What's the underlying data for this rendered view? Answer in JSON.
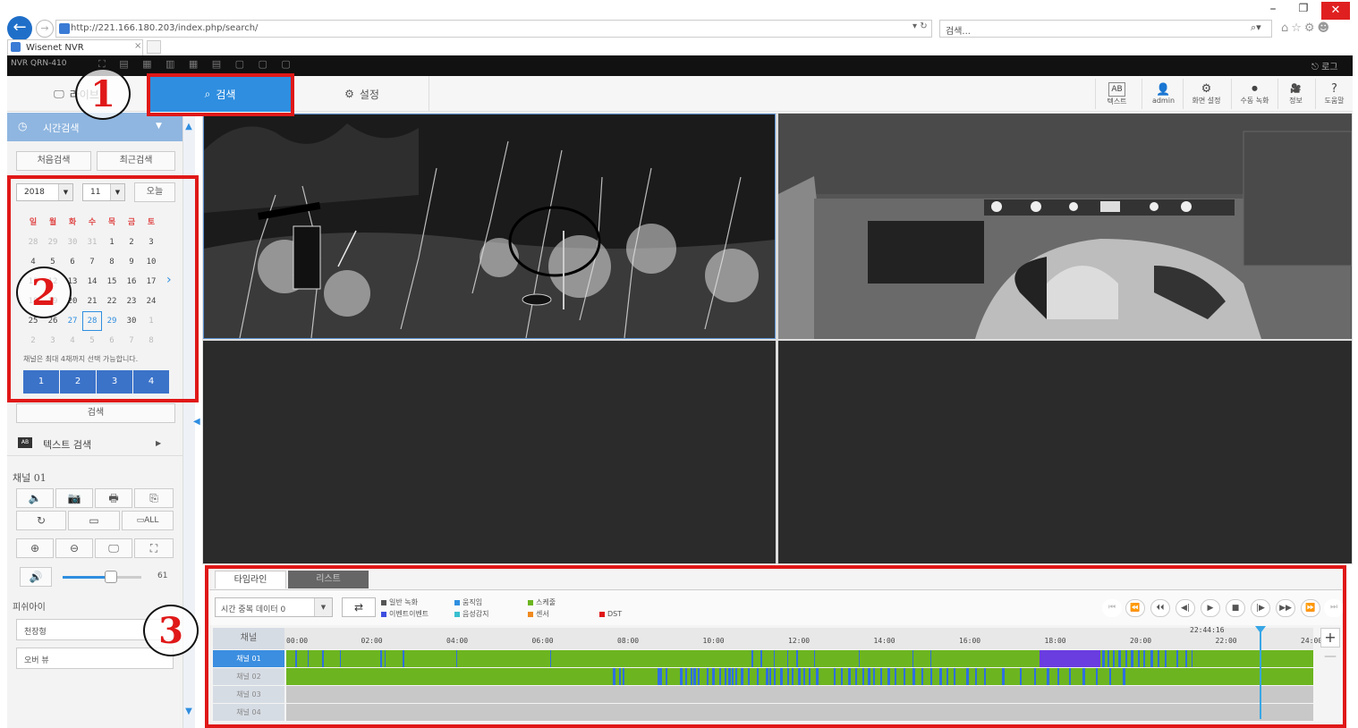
{
  "browser": {
    "url": "http://221.166.180.203/index.php/search/",
    "search_placeholder": "검색...",
    "tab_title": "Wisenet NVR",
    "tab_close": "×",
    "refresh": "▾ ↻",
    "search_icon": "⌕▾",
    "minimize": "–",
    "maximize": "❐",
    "close": "✕",
    "toolbar_icons": "⌂☆⚙☻"
  },
  "app": {
    "title": "NVR QRN-410",
    "logout": "⎋ 로그",
    "title_toolbar": "⛶ ▤ ▦ ▥ ▦ ▤ ▢ ▢ ▢"
  },
  "nav": {
    "live": "라이브",
    "search": "검색",
    "setup": "설정",
    "right_items": [
      {
        "label": "텍스트",
        "icon": "AB"
      },
      {
        "label": "admin",
        "icon": "👤"
      },
      {
        "label": "화면 설정",
        "icon": "⚙"
      },
      {
        "label": "수동 녹화",
        "icon": "⏺"
      },
      {
        "label": "정보",
        "icon": "🎥"
      },
      {
        "label": "도움말",
        "icon": "?"
      }
    ]
  },
  "sidebar": {
    "time_search": "시간검색",
    "first_search": "처음검색",
    "recent_search": "최근검색",
    "year": "2018",
    "month": "11",
    "today": "오늘",
    "weekdays": [
      "일",
      "월",
      "화",
      "수",
      "목",
      "금",
      "토"
    ],
    "calendar": [
      [
        "28",
        "29",
        "30",
        "31",
        "1",
        "2",
        "3"
      ],
      [
        "4",
        "5",
        "6",
        "7",
        "8",
        "9",
        "10"
      ],
      [
        "11",
        "12",
        "13",
        "14",
        "15",
        "16",
        "17"
      ],
      [
        "18",
        "19",
        "20",
        "21",
        "22",
        "23",
        "24"
      ],
      [
        "25",
        "26",
        "27",
        "28",
        "29",
        "30",
        "1"
      ],
      [
        "2",
        "3",
        "4",
        "5",
        "6",
        "7",
        "8"
      ]
    ],
    "channel_note": "채널은 최대 4채까지 선택 가능합니다.",
    "channels": [
      "1",
      "2",
      "3",
      "4"
    ],
    "search_button": "검색",
    "text_search": "텍스트 검색",
    "channel_label": "채널 01",
    "volume": "61",
    "fisheye_label": "피쉬아이",
    "fisheye_mount": "천장형",
    "fisheye_view": "오버 뷰"
  },
  "timeline": {
    "tab_timeline": "타임라인",
    "tab_list": "리스트",
    "mode_select": "시간 중복 데이터 0",
    "legend": [
      {
        "label": "일반 녹화",
        "color": "#6cb520"
      },
      {
        "label": "이벤트이벤트",
        "color": "#3d4fe0"
      },
      {
        "label": "움직임",
        "color": "#2f8ee0"
      },
      {
        "label": "음성감지",
        "color": "#39c0d0"
      },
      {
        "label": "스케줄",
        "color": "#6cb520"
      },
      {
        "label": "센서",
        "color": "#f08a20"
      },
      {
        "label": "DST",
        "color": "#e01818"
      }
    ],
    "header_label": "채널",
    "ticks": [
      "00:00",
      "02:00",
      "04:00",
      "06:00",
      "08:00",
      "10:00",
      "12:00",
      "14:00",
      "16:00",
      "18:00",
      "20:00",
      "22:00",
      "24:00"
    ],
    "current_time": "22:44:16",
    "rows": [
      "채널 01",
      "채널 02",
      "채널 03",
      "채널 04"
    ],
    "zoom_in": "+",
    "zoom_out": "—",
    "playback": [
      "⏮",
      "⏪",
      "⏴⏴",
      "◀|",
      "▶",
      "■",
      "|▶",
      "▶▶",
      "⏩",
      "⏭"
    ]
  },
  "annotations": [
    "1",
    "2",
    "3"
  ],
  "colors": {
    "accent": "#2f8ee0",
    "annotation_red": "#e01818",
    "recording_green": "#6cb520",
    "event_purple": "#6a3de0",
    "motion_blue": "#2f6fe0"
  }
}
